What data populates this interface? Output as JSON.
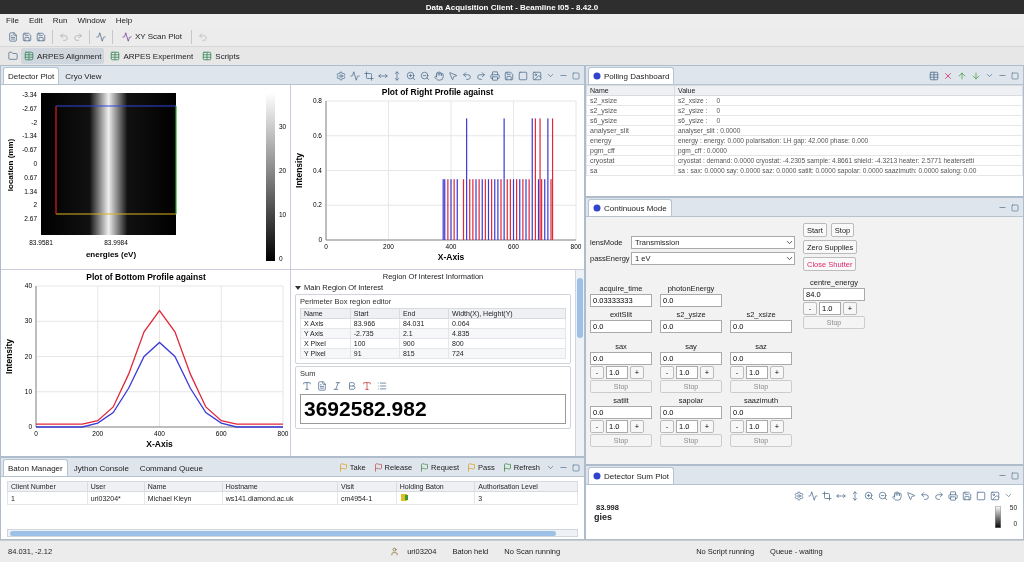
{
  "window": {
    "title": "Data Acquisition Client - Beamline I05 - 8.42.0"
  },
  "menu": [
    "File",
    "Edit",
    "Run",
    "Window",
    "Help"
  ],
  "toolbar": {
    "plot_button": "XY Scan Plot"
  },
  "perspectives": [
    {
      "label": "ARPES Alignment",
      "selected": true
    },
    {
      "label": "ARPES Experiment",
      "selected": false
    },
    {
      "label": "Scripts",
      "selected": false
    }
  ],
  "detector_view": {
    "tabs": [
      {
        "label": "Detector Plot",
        "selected": true
      },
      {
        "label": "Cryo View",
        "selected": false
      }
    ],
    "image_plot": {
      "ylabel": "location (mm)",
      "xlabel": "energies (eV)",
      "yticks": [
        "-3.34",
        "-2.67",
        "-2",
        "-1.34",
        "-0.67",
        "0",
        "0.67",
        "1.34",
        "2",
        "2.67"
      ],
      "xticks": [
        "83.9581",
        "83.9984"
      ],
      "colorbar_ticks": [
        "30",
        "20",
        "10",
        "0"
      ]
    },
    "right_profile": {
      "chart_data": {
        "type": "bar",
        "title": "Plot of Right Profile against",
        "xlabel": "X-Axis",
        "ylabel": "Intensity",
        "x": [
          375,
          380,
          390,
          400,
          410,
          420,
          440,
          450,
          460,
          470,
          480,
          490,
          500,
          510,
          520,
          530,
          540,
          550,
          560,
          570,
          580,
          590,
          600,
          610,
          620,
          630,
          640,
          650,
          660,
          670,
          680,
          685,
          690,
          700,
          710,
          720,
          725
        ],
        "series": [
          {
            "color": "#3a3ad8",
            "values": [
              0.35,
              0.35,
              null,
              0.35,
              null,
              0.35,
              null,
              0.7,
              null,
              null,
              0.35,
              null,
              0.35,
              null,
              0.35,
              null,
              0.35,
              0.35,
              null,
              0.7,
              null,
              null,
              0.35,
              null,
              0.35,
              null,
              0.35,
              null,
              0.7,
              null,
              0.35,
              null,
              null,
              0.35,
              0.7,
              null,
              null
            ]
          },
          {
            "color": "#e02838",
            "values": [
              null,
              null,
              0.35,
              null,
              0.35,
              null,
              0.35,
              null,
              0.35,
              0.35,
              null,
              0.35,
              null,
              0.35,
              null,
              0.35,
              null,
              null,
              0.35,
              null,
              0.35,
              0.35,
              null,
              0.35,
              null,
              0.35,
              null,
              0.35,
              null,
              0.7,
              null,
              0.7,
              0.35,
              null,
              null,
              0.35,
              0.7
            ]
          }
        ],
        "xlim": [
          0,
          800
        ],
        "ylim": [
          0,
          0.8
        ],
        "xticks": [
          0,
          200,
          400,
          600,
          800
        ],
        "yticks": [
          0,
          0.2,
          0.4,
          0.6,
          0.8
        ],
        "grid": true
      }
    },
    "bottom_profile": {
      "chart_data": {
        "type": "line",
        "title": "Plot of Bottom Profile against",
        "xlabel": "X-Axis",
        "ylabel": "Intensity",
        "x": [
          0,
          50,
          100,
          150,
          200,
          250,
          300,
          350,
          400,
          450,
          500,
          550,
          600,
          650,
          700,
          750,
          800
        ],
        "series": [
          {
            "color": "#e02838",
            "values": [
              0.8,
              0.8,
              0.8,
              0.8,
              1.8,
              5.7,
              15,
              27,
              33,
              27,
              15,
              5.7,
              1.8,
              0.8,
              0.8,
              0.8,
              0.8
            ]
          },
          {
            "color": "#3a3ad8",
            "values": [
              0,
              0,
              0,
              0,
              1.1,
              4.1,
              11,
              20,
              24,
              20,
              11,
              4.1,
              1.1,
              0,
              0,
              0,
              0
            ]
          }
        ],
        "xlim": [
          0,
          800
        ],
        "ylim": [
          0,
          40
        ],
        "xticks": [
          0,
          200,
          400,
          600,
          800
        ],
        "yticks": [
          0,
          10,
          20,
          30,
          40
        ],
        "grid": true
      }
    },
    "roi": {
      "title": "Region Of Interest Information",
      "section": {
        "label": "Main Region Of Interest",
        "expanded": true
      },
      "editor": {
        "title": "Perimeter Box region editor",
        "columns": [
          "Name",
          "Start",
          "End",
          "Width(X), Height(Y)"
        ],
        "rows": [
          [
            "X Axis",
            "83.966",
            "84.031",
            "0.064"
          ],
          [
            "Y Axis",
            "-2.735",
            "2.1",
            "4.835"
          ],
          [
            "X Pixel",
            "100",
            "900",
            "800"
          ],
          [
            "Y Pixel",
            "91",
            "815",
            "724"
          ]
        ]
      },
      "sum": {
        "label": "Sum",
        "value": "3692582.982"
      }
    }
  },
  "polling": {
    "tab": "Polling Dashboard",
    "columns": [
      "Name",
      "Value"
    ],
    "rows": [
      {
        "name": "s2_xsize",
        "value": "s2_xsize :     0"
      },
      {
        "name": "s2_ysize",
        "value": "s2_ysize :     0"
      },
      {
        "name": "s6_ysize",
        "value": "s6_ysize :     0"
      },
      {
        "name": "analyser_slit",
        "value": "analyser_slit : 0.0000"
      },
      {
        "name": "energy",
        "value": "energy : energy: 0.000 polarisation: LH gap: 42.000 phase: 0.000"
      },
      {
        "name": "pgm_cff",
        "value": "pgm_cff : 0.0000"
      },
      {
        "name": "cryostat",
        "value": "cryostat : demand: 0.0000 cryostat: -4.2305 sample: 4.8661 shield: -4.3213 heater: 2.5771 heatersetti"
      },
      {
        "name": "sa",
        "value": "sa : sax: 0.0000 say: 0.0000 saz: 0.0000 satilt: 0.0000 sapolar: 0.0000 saazimuth: 0.0000 salong: 0.00"
      }
    ]
  },
  "continuous": {
    "tab": "Continuous Mode",
    "selects": [
      {
        "label": "lensMode",
        "value": "Transmission"
      },
      {
        "label": "passEnergy",
        "value": "1 eV"
      }
    ],
    "buttons": [
      {
        "label": "Start",
        "kind": "normal"
      },
      {
        "label": "Stop",
        "kind": "normal"
      },
      {
        "label": "Zero Supplies",
        "kind": "normal"
      },
      {
        "label": "Close Shutter",
        "kind": "warning"
      }
    ],
    "centre": {
      "kind": "motor",
      "label": "centre_energy",
      "value": "84.0",
      "minus": "-",
      "step": "1.0",
      "plus": "+",
      "stop": {
        "label": "Stop",
        "disabled": true
      }
    },
    "rows": [
      [
        {
          "kind": "field",
          "label": "acquire_time",
          "value": "0.03333333"
        },
        {
          "kind": "field",
          "label": "photonEnergy",
          "value": "0.0"
        }
      ],
      [
        {
          "kind": "field",
          "label": "exitSlit",
          "value": "0.0"
        },
        {
          "kind": "field",
          "label": "s2_ysize",
          "value": "0.0"
        },
        {
          "kind": "field",
          "label": "s2_xsize",
          "value": "0.0"
        }
      ],
      [
        {
          "kind": "motor",
          "label": "sax",
          "value": "0.0",
          "minus": "-",
          "step": "1.0",
          "plus": "+",
          "stop": {
            "label": "Stop",
            "disabled": true
          }
        },
        {
          "kind": "motor",
          "label": "say",
          "value": "0.0",
          "minus": "-",
          "step": "1.0",
          "plus": "+",
          "stop": {
            "label": "Stop",
            "disabled": true
          }
        },
        {
          "kind": "motor",
          "label": "saz",
          "value": "0.0",
          "minus": "-",
          "step": "1.0",
          "plus": "+",
          "stop": {
            "label": "Stop",
            "disabled": true
          }
        }
      ],
      [
        {
          "kind": "motor",
          "label": "satilt",
          "value": "0.0",
          "minus": "-",
          "step": "1.0",
          "plus": "+",
          "stop": {
            "label": "Stop",
            "disabled": true
          }
        },
        {
          "kind": "motor",
          "label": "sapolar",
          "value": "0.0",
          "minus": "-",
          "step": "1.0",
          "plus": "+",
          "stop": {
            "label": "Stop",
            "disabled": true
          }
        },
        {
          "kind": "motor",
          "label": "saazimuth",
          "value": "0.0",
          "minus": "-",
          "step": "1.0",
          "plus": "+",
          "stop": {
            "label": "Stop",
            "disabled": true
          }
        }
      ]
    ]
  },
  "baton": {
    "tabs": [
      {
        "label": "Baton Manager",
        "selected": true
      },
      {
        "label": "Jython Console",
        "selected": false
      },
      {
        "label": "Command Queue",
        "selected": false
      }
    ],
    "actions": [
      "Take",
      "Release",
      "Request",
      "Pass",
      "Refresh"
    ],
    "columns": [
      "Client Number",
      "User",
      "Name",
      "Hostname",
      "Visit",
      "Holding Baton",
      "Authorisation Level"
    ],
    "rows": [
      {
        "client": "1",
        "user": "uri03204*",
        "name": "Michael Kleyn",
        "hostname": "ws141.diamond.ac.uk",
        "visit": "cm4954-1",
        "holding_baton": true,
        "level": "3"
      }
    ]
  },
  "sum_plot": {
    "tab": "Detector Sum Plot",
    "tick": "83.998",
    "axis_fragment": "gies",
    "colorbar_ticks": [
      "50",
      "0"
    ]
  },
  "status_bar": {
    "coordinates": "84.031, -2.12",
    "user": "uri03204",
    "baton": "Baton held",
    "scan": "No Scan running",
    "script": "No Script running",
    "queue": "Queue - waiting"
  }
}
